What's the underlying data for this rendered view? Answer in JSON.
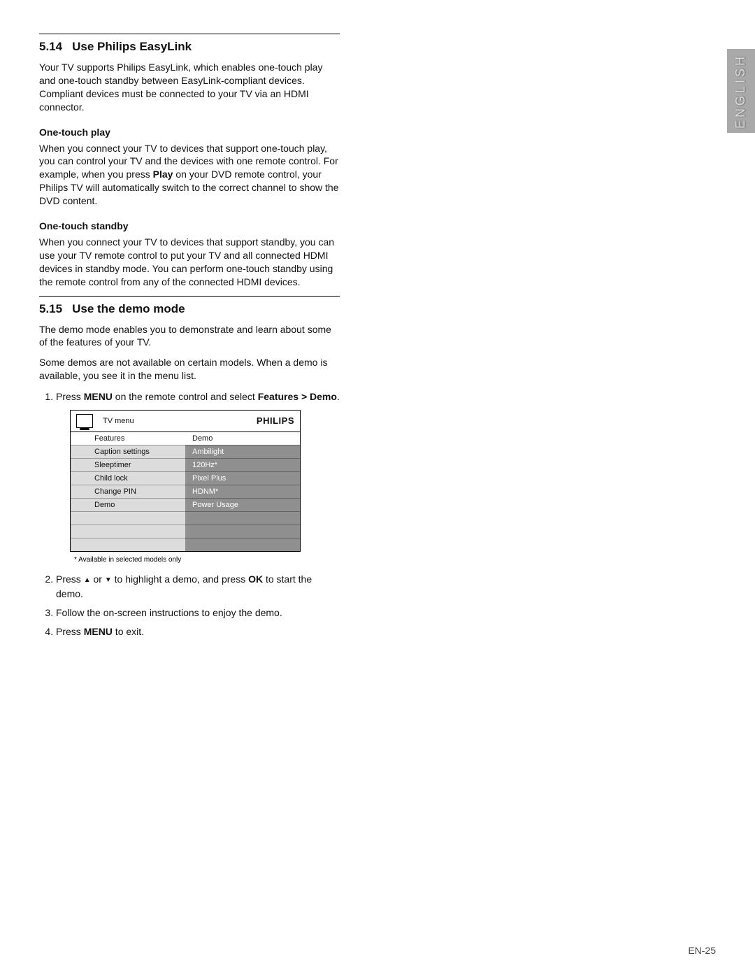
{
  "language_tab": "ENGLISH",
  "page_number": "EN-25",
  "sections": {
    "easylink": {
      "number": "5.14",
      "title": "Use Philips EasyLink",
      "intro": "Your TV supports Philips EasyLink, which enables one-touch play and one-touch standby between EasyLink-compliant devices.  Compliant devices must be connected to your TV via an HDMI connector.",
      "sub1_title": "One-touch play",
      "sub1_body_a": "When you connect your TV to devices that support one-touch play, you can control your TV and the devices with one remote control.  For example, when you press ",
      "sub1_body_play": "Play",
      "sub1_body_b": " on your DVD remote control, your Philips TV will automatically switch to the correct channel to show the DVD content.",
      "sub2_title": "One-touch standby",
      "sub2_body": "When you connect your TV to devices that support standby, you can use your TV remote control to put your TV and all connected HDMI devices in standby mode.  You can perform one-touch standby using the remote control from any of the connected HDMI devices."
    },
    "demo": {
      "number": "5.15",
      "title": "Use the demo mode",
      "intro1": "The demo mode enables you to demonstrate and learn about some of the features of your TV.",
      "intro2": "Some demos are not available on certain models.  When a demo is available, you see it in the menu list.",
      "step1_a": "Press ",
      "step1_menu": "MENU",
      "step1_b": " on the remote control and select ",
      "step1_path": "Features > Demo",
      "step1_c": ".",
      "step2_a": "Press ",
      "step2_b": " or ",
      "step2_c": " to highlight a demo, and press ",
      "step2_ok": "OK",
      "step2_d": " to start the demo.",
      "step3": "Follow the on-screen instructions to enjoy the demo.",
      "step4_a": "Press ",
      "step4_menu": "MENU",
      "step4_b": " to exit."
    }
  },
  "menu": {
    "title": "TV menu",
    "brand": "PHILIPS",
    "left_header": "Features",
    "right_header": "Demo",
    "left": [
      "Caption settings",
      "Sleeptimer",
      "Child lock",
      "Change PIN",
      "Demo",
      "",
      "",
      ""
    ],
    "right": [
      "Ambilight",
      "120Hz*",
      "Pixel Plus",
      "HDNM*",
      "Power Usage",
      "",
      "",
      ""
    ],
    "note": "* Available in selected models only"
  }
}
